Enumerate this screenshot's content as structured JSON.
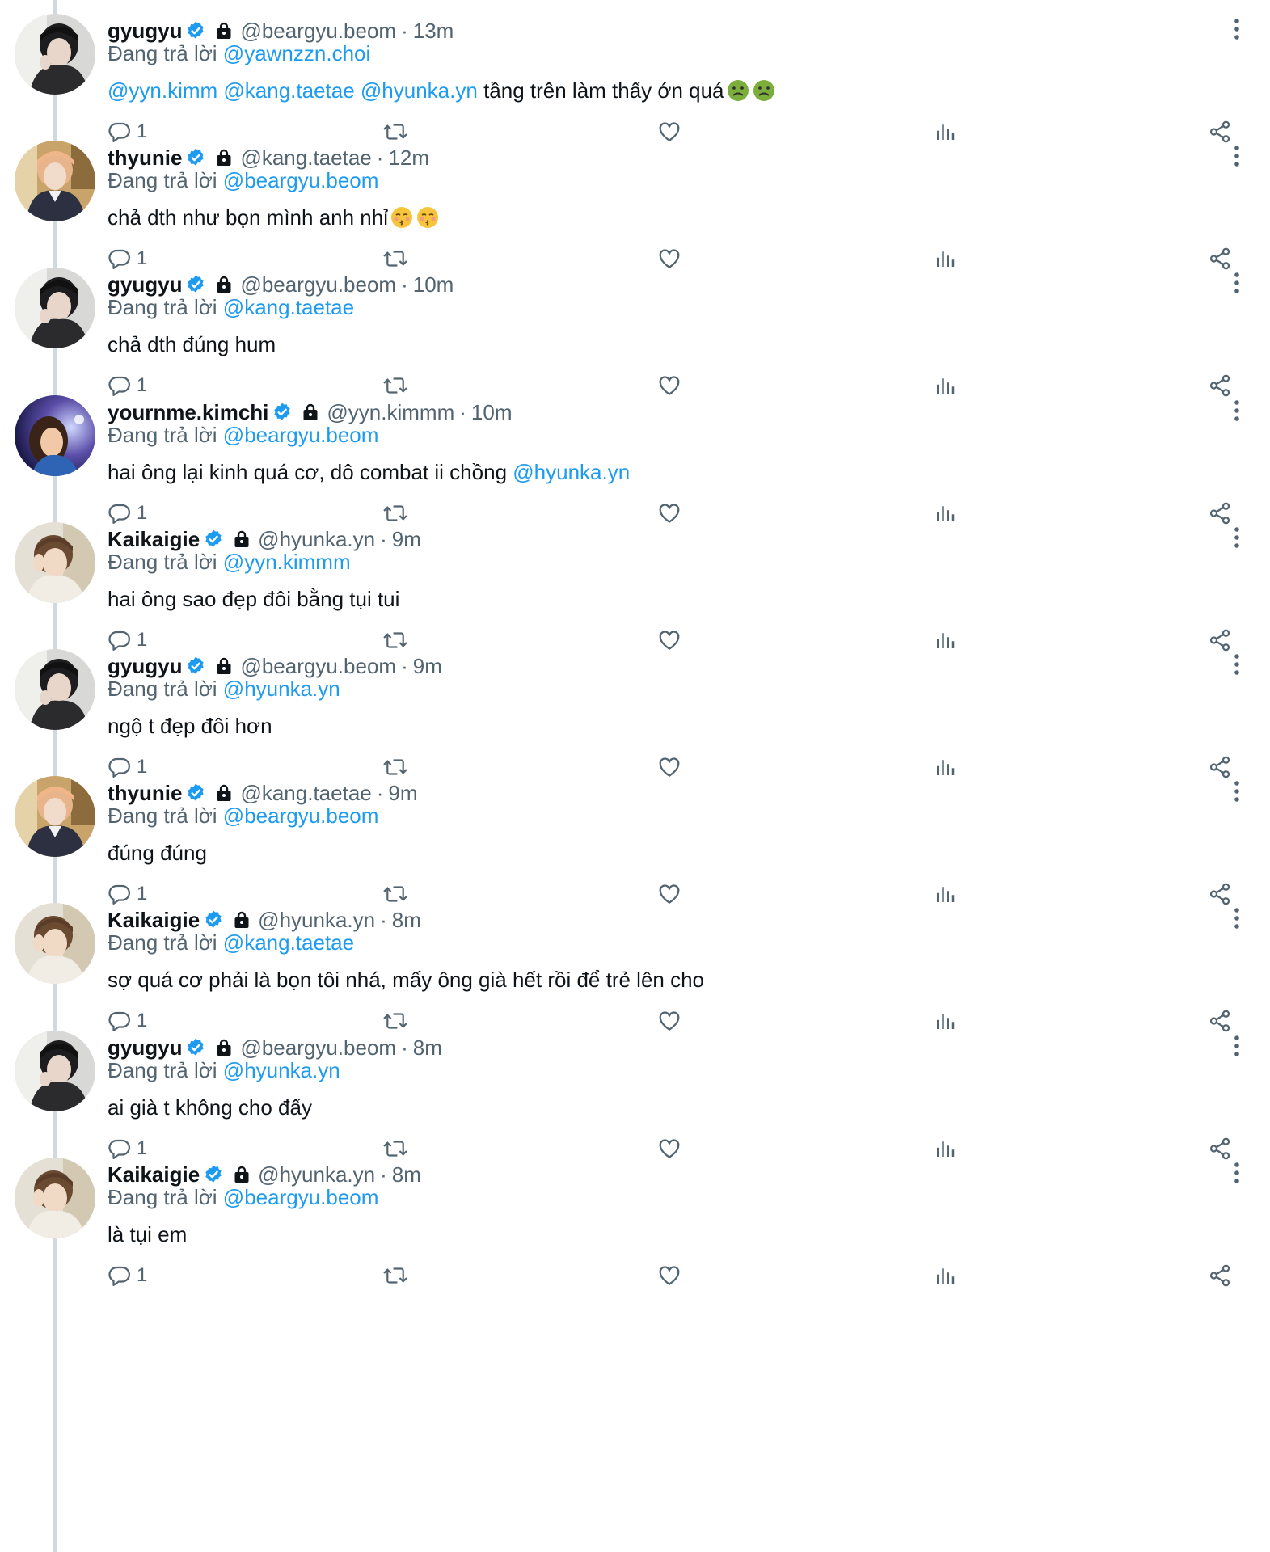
{
  "reply_prefix": "Đang trả lời",
  "tweets": [
    {
      "display_name": "gyugyu",
      "handle": "@beargyu.beom",
      "time": "13m",
      "reply_to": "@yawnzzn.choi",
      "mentions": "@yyn.kimm @kang.taetae @hyunka.yn",
      "text": "tầng trên làm thấy ớn quá",
      "emojis": [
        "nauseated-face",
        "nauseated-face"
      ],
      "reply_count": "1",
      "avatar": "avatar-gyugyu"
    },
    {
      "display_name": "thyunie",
      "handle": "@kang.taetae",
      "time": "12m",
      "reply_to": "@beargyu.beom",
      "text": "chả dth như bọn mình anh nhỉ",
      "emojis": [
        "kissing-face",
        "kissing-face"
      ],
      "reply_count": "1",
      "avatar": "avatar-thyunie"
    },
    {
      "display_name": "gyugyu",
      "handle": "@beargyu.beom",
      "time": "10m",
      "reply_to": "@kang.taetae",
      "text": "chả dth đúng hum",
      "reply_count": "1",
      "avatar": "avatar-gyugyu"
    },
    {
      "display_name": "yournme.kimchi",
      "handle": "@yyn.kimmm",
      "time": "10m",
      "reply_to": "@beargyu.beom",
      "text": "hai ông lại kinh quá cơ, dô combat ii chồng",
      "trailing_mention": "@hyunka.yn",
      "reply_count": "1",
      "avatar": "avatar-yournme"
    },
    {
      "display_name": "Kaikaigie",
      "handle": "@hyunka.yn",
      "time": "9m",
      "reply_to": "@yyn.kimmm",
      "text": "hai ông sao đẹp đôi bằng tụi tui",
      "reply_count": "1",
      "avatar": "avatar-kaikaigie"
    },
    {
      "display_name": "gyugyu",
      "handle": "@beargyu.beom",
      "time": "9m",
      "reply_to": "@hyunka.yn",
      "text": "ngộ t đẹp đôi hơn",
      "reply_count": "1",
      "avatar": "avatar-gyugyu"
    },
    {
      "display_name": "thyunie",
      "handle": "@kang.taetae",
      "time": "9m",
      "reply_to": "@beargyu.beom",
      "text": "đúng đúng",
      "reply_count": "1",
      "avatar": "avatar-thyunie"
    },
    {
      "display_name": "Kaikaigie",
      "handle": "@hyunka.yn",
      "time": "8m",
      "reply_to": "@kang.taetae",
      "text": "sợ quá cơ phải là bọn tôi nhá, mấy ông già hết rồi để trẻ lên cho",
      "reply_count": "1",
      "avatar": "avatar-kaikaigie"
    },
    {
      "display_name": "gyugyu",
      "handle": "@beargyu.beom",
      "time": "8m",
      "reply_to": "@hyunka.yn",
      "text": "ai già t không cho đấy",
      "reply_count": "1",
      "avatar": "avatar-gyugyu"
    },
    {
      "display_name": "Kaikaigie",
      "handle": "@hyunka.yn",
      "time": "8m",
      "reply_to": "@beargyu.beom",
      "text": "là tụi em",
      "reply_count": "1",
      "avatar": "avatar-kaikaigie"
    }
  ],
  "colors": {
    "accent": "#1d9bf0",
    "muted": "#536471",
    "text": "#0f1419",
    "thread_line": "#cfd9de"
  },
  "icons": {
    "verified": "verified-badge-icon",
    "lock": "lock-icon",
    "more": "more-vertical-icon",
    "reply": "reply-icon",
    "retweet": "retweet-icon",
    "like": "heart-icon",
    "views": "views-icon",
    "share": "share-icon"
  }
}
